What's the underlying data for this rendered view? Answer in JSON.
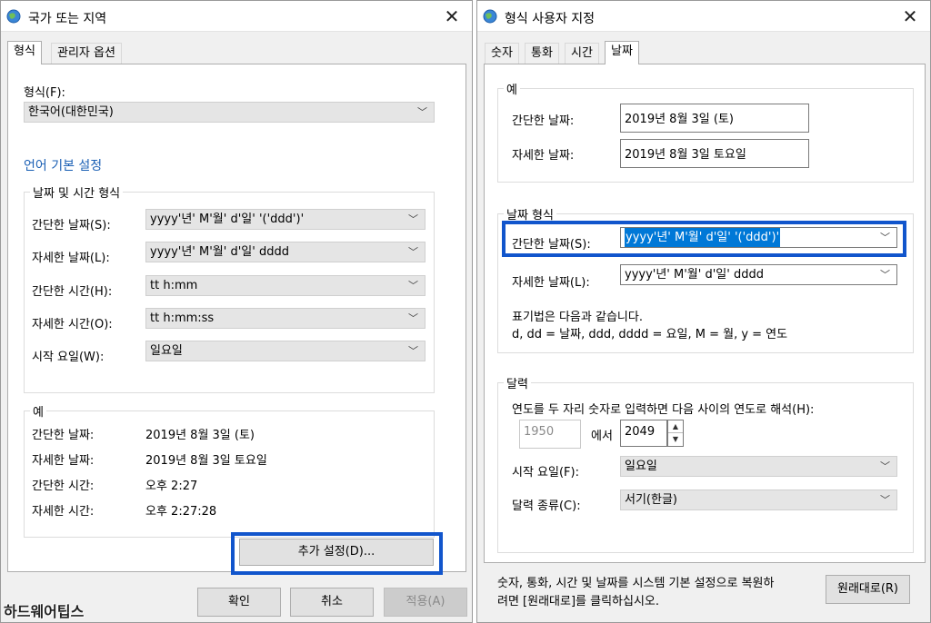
{
  "left": {
    "title": "국가 또는 지역",
    "tabs": [
      "형식",
      "관리자 옵션"
    ],
    "format_label": "형식(F):",
    "format_value": "한국어(대한민국)",
    "lang_link": "언어 기본 설정",
    "datetime_group": "날짜 및 시간 형식",
    "rows": [
      {
        "label": "간단한 날짜(S):",
        "value": "yyyy'년' M'월' d'일' '('ddd')'"
      },
      {
        "label": "자세한 날짜(L):",
        "value": "yyyy'년' M'월' d'일' dddd"
      },
      {
        "label": "간단한 시간(H):",
        "value": "tt h:mm"
      },
      {
        "label": "자세한 시간(O):",
        "value": "tt h:mm:ss"
      },
      {
        "label": "시작 요일(W):",
        "value": "일요일"
      }
    ],
    "example_group": "예",
    "examples": [
      {
        "label": "간단한 날짜:",
        "value": "2019년 8월 3일 (토)"
      },
      {
        "label": "자세한 날짜:",
        "value": "2019년 8월 3일 토요일"
      },
      {
        "label": "간단한 시간:",
        "value": "오후 2:27"
      },
      {
        "label": "자세한 시간:",
        "value": "오후 2:27:28"
      }
    ],
    "extra_btn": "추가 설정(D)...",
    "ok_btn": "확인",
    "cancel_btn": "취소",
    "apply_btn": "적용(A)"
  },
  "right": {
    "title": "형식 사용자 지정",
    "tabs": [
      "숫자",
      "통화",
      "시간",
      "날짜"
    ],
    "example_group": "예",
    "ex_short_label": "간단한 날짜:",
    "ex_short_value": "2019년 8월 3일 (토)",
    "ex_long_label": "자세한 날짜:",
    "ex_long_value": "2019년 8월 3일 토요일",
    "date_format_group": "날짜 형식",
    "short_label": "간단한 날짜(S):",
    "short_value": "yyyy'년' M'월' d'일' '('ddd')'",
    "long_label": "자세한 날짜(L):",
    "long_value": "yyyy'년' M'월' d'일' dddd",
    "notation_line1": "표기법은 다음과 같습니다.",
    "notation_line2": "d, dd = 날짜,  ddd, dddd = 요일,  M = 월,  y = 연도",
    "calendar_group": "달력",
    "twodigit_text": "연도를 두 자리 숫자로 입력하면 다음 사이의 연도로 해석(H):",
    "year_from": "1950",
    "year_between": "에서",
    "year_to": "2049",
    "firstday_label": "시작 요일(F):",
    "firstday_value": "일요일",
    "caltype_label": "달력 종류(C):",
    "caltype_value": "서기(한글)",
    "reset_text_1": "숫자, 통화, 시간 및 날짜를 시스템 기본 설정으로 복원하",
    "reset_text_2": "려면 [원래대로]를 클릭하십시오.",
    "reset_btn": "원래대로(R)"
  },
  "watermark": "하드웨어팁스"
}
